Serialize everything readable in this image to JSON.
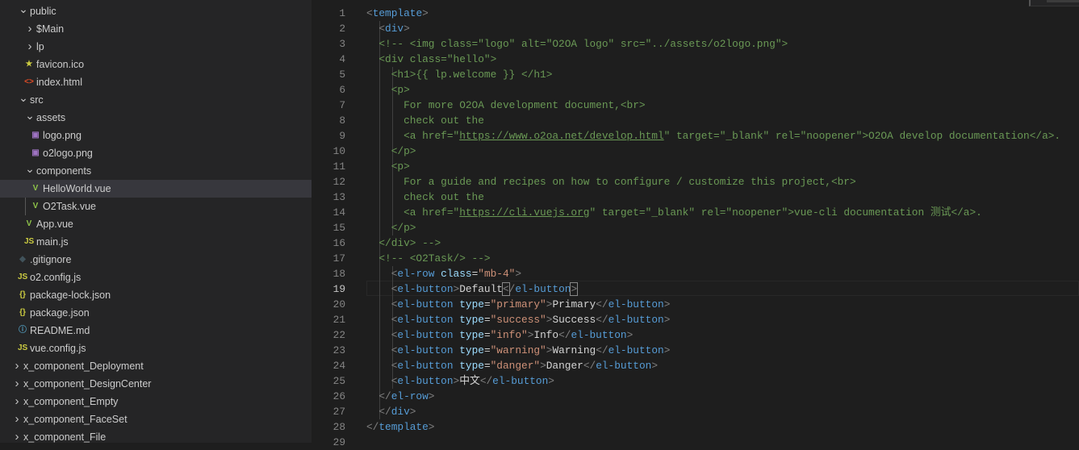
{
  "explorer": {
    "items": [
      {
        "label": "public",
        "kind": "folder-open",
        "level": 1
      },
      {
        "label": "$Main",
        "kind": "folder-closed",
        "level": 2
      },
      {
        "label": "lp",
        "kind": "folder-closed",
        "level": 2
      },
      {
        "label": "favicon.ico",
        "kind": "star",
        "level": 2
      },
      {
        "label": "index.html",
        "kind": "html",
        "level": 2
      },
      {
        "label": "src",
        "kind": "folder-open",
        "level": 1
      },
      {
        "label": "assets",
        "kind": "folder-open",
        "level": 2
      },
      {
        "label": "logo.png",
        "kind": "image",
        "level": 3
      },
      {
        "label": "o2logo.png",
        "kind": "image",
        "level": 3
      },
      {
        "label": "components",
        "kind": "folder-open",
        "level": 2
      },
      {
        "label": "HelloWorld.vue",
        "kind": "vue",
        "level": 3,
        "selected": true
      },
      {
        "label": "O2Task.vue",
        "kind": "vue",
        "level": 3
      },
      {
        "label": "App.vue",
        "kind": "vue",
        "level": 2
      },
      {
        "label": "main.js",
        "kind": "js",
        "level": 2
      },
      {
        "label": ".gitignore",
        "kind": "git",
        "level": 1
      },
      {
        "label": "o2.config.js",
        "kind": "js",
        "level": 1
      },
      {
        "label": "package-lock.json",
        "kind": "json",
        "level": 1
      },
      {
        "label": "package.json",
        "kind": "json",
        "level": 1
      },
      {
        "label": "README.md",
        "kind": "info",
        "level": 1
      },
      {
        "label": "vue.config.js",
        "kind": "js",
        "level": 1
      },
      {
        "label": "x_component_Deployment",
        "kind": "folder-closed",
        "level": 0
      },
      {
        "label": "x_component_DesignCenter",
        "kind": "folder-closed",
        "level": 0
      },
      {
        "label": "x_component_Empty",
        "kind": "folder-closed",
        "level": 0
      },
      {
        "label": "x_component_FaceSet",
        "kind": "folder-closed",
        "level": 0
      },
      {
        "label": "x_component_File",
        "kind": "folder-closed",
        "level": 0
      }
    ]
  },
  "icons": {
    "folder-open": "⌄",
    "folder-closed": "›",
    "star": "★",
    "html": "<>",
    "image": "▣",
    "vue": "V",
    "js": "JS",
    "git": "◆",
    "json": "{}",
    "info": "ⓘ"
  },
  "icon_colors": {
    "star": "#cbcb41",
    "html": "#e44d26",
    "image": "#a074c4",
    "vue": "#8dc149",
    "js": "#cbcb41",
    "git": "#41535b",
    "json": "#cbcb41",
    "info": "#519aba"
  },
  "editor": {
    "current_line": 19,
    "lines": [
      {
        "n": "1",
        "tokens": [
          [
            "p",
            "<"
          ],
          [
            "t",
            "template"
          ],
          [
            "p",
            ">"
          ]
        ]
      },
      {
        "n": "2",
        "tokens": [
          [
            "x",
            "  "
          ],
          [
            "p",
            "<"
          ],
          [
            "t",
            "div"
          ],
          [
            "p",
            ">"
          ]
        ]
      },
      {
        "n": "3",
        "tokens": [
          [
            "c",
            "  <!-- <img class=\"logo\" alt=\"O2OA logo\" src=\"../assets/o2logo.png\">"
          ]
        ]
      },
      {
        "n": "4",
        "tokens": [
          [
            "c",
            "  <div class=\"hello\">"
          ]
        ]
      },
      {
        "n": "5",
        "tokens": [
          [
            "c",
            "    <h1>{{ lp.welcome }} </h1>"
          ]
        ]
      },
      {
        "n": "6",
        "tokens": [
          [
            "c",
            "    <p>"
          ]
        ]
      },
      {
        "n": "7",
        "tokens": [
          [
            "c",
            "      For more O2OA development document,<br>"
          ]
        ]
      },
      {
        "n": "8",
        "tokens": [
          [
            "c",
            "      check out the"
          ]
        ]
      },
      {
        "n": "9",
        "tokens": [
          [
            "c",
            "      <a href=\""
          ],
          [
            "u",
            "https://www.o2oa.net/develop.html"
          ],
          [
            "c",
            "\" target=\"_blank\" rel=\"noopener\">O2OA develop documentation</a>."
          ]
        ]
      },
      {
        "n": "10",
        "tokens": [
          [
            "c",
            "    </p>"
          ]
        ]
      },
      {
        "n": "11",
        "tokens": [
          [
            "c",
            "    <p>"
          ]
        ]
      },
      {
        "n": "12",
        "tokens": [
          [
            "c",
            "      For a guide and recipes on how to configure / customize this project,<br>"
          ]
        ]
      },
      {
        "n": "13",
        "tokens": [
          [
            "c",
            "      check out the"
          ]
        ]
      },
      {
        "n": "14",
        "tokens": [
          [
            "c",
            "      <a href=\""
          ],
          [
            "u",
            "https://cli.vuejs.org"
          ],
          [
            "c",
            "\" target=\"_blank\" rel=\"noopener\">vue-cli documentation 测试</a>."
          ]
        ]
      },
      {
        "n": "15",
        "tokens": [
          [
            "c",
            "    </p>"
          ]
        ]
      },
      {
        "n": "16",
        "tokens": [
          [
            "c",
            "  </div> -->"
          ]
        ]
      },
      {
        "n": "17",
        "tokens": [
          [
            "c",
            "  <!-- <O2Task/> -->"
          ]
        ]
      },
      {
        "n": "18",
        "tokens": [
          [
            "x",
            "    "
          ],
          [
            "p",
            "<"
          ],
          [
            "t",
            "el-row"
          ],
          [
            "x",
            " "
          ],
          [
            "a",
            "class"
          ],
          [
            "x",
            "="
          ],
          [
            "s",
            "\"mb-4\""
          ],
          [
            "p",
            ">"
          ]
        ]
      },
      {
        "n": "19",
        "tokens": [
          [
            "x",
            "    "
          ],
          [
            "p",
            "<"
          ],
          [
            "t",
            "el-button"
          ],
          [
            "p",
            ">"
          ],
          [
            "x",
            "Default"
          ],
          [
            "b",
            "<"
          ],
          [
            "p",
            "/"
          ],
          [
            "t",
            "el-button"
          ],
          [
            "b",
            ">"
          ]
        ]
      },
      {
        "n": "20",
        "tokens": [
          [
            "x",
            "    "
          ],
          [
            "p",
            "<"
          ],
          [
            "t",
            "el-button"
          ],
          [
            "x",
            " "
          ],
          [
            "a",
            "type"
          ],
          [
            "x",
            "="
          ],
          [
            "s",
            "\"primary\""
          ],
          [
            "p",
            ">"
          ],
          [
            "x",
            "Primary"
          ],
          [
            "p",
            "</"
          ],
          [
            "t",
            "el-button"
          ],
          [
            "p",
            ">"
          ]
        ]
      },
      {
        "n": "21",
        "tokens": [
          [
            "x",
            "    "
          ],
          [
            "p",
            "<"
          ],
          [
            "t",
            "el-button"
          ],
          [
            "x",
            " "
          ],
          [
            "a",
            "type"
          ],
          [
            "x",
            "="
          ],
          [
            "s",
            "\"success\""
          ],
          [
            "p",
            ">"
          ],
          [
            "x",
            "Success"
          ],
          [
            "p",
            "</"
          ],
          [
            "t",
            "el-button"
          ],
          [
            "p",
            ">"
          ]
        ]
      },
      {
        "n": "22",
        "tokens": [
          [
            "x",
            "    "
          ],
          [
            "p",
            "<"
          ],
          [
            "t",
            "el-button"
          ],
          [
            "x",
            " "
          ],
          [
            "a",
            "type"
          ],
          [
            "x",
            "="
          ],
          [
            "s",
            "\"info\""
          ],
          [
            "p",
            ">"
          ],
          [
            "x",
            "Info"
          ],
          [
            "p",
            "</"
          ],
          [
            "t",
            "el-button"
          ],
          [
            "p",
            ">"
          ]
        ]
      },
      {
        "n": "23",
        "tokens": [
          [
            "x",
            "    "
          ],
          [
            "p",
            "<"
          ],
          [
            "t",
            "el-button"
          ],
          [
            "x",
            " "
          ],
          [
            "a",
            "type"
          ],
          [
            "x",
            "="
          ],
          [
            "s",
            "\"warning\""
          ],
          [
            "p",
            ">"
          ],
          [
            "x",
            "Warning"
          ],
          [
            "p",
            "</"
          ],
          [
            "t",
            "el-button"
          ],
          [
            "p",
            ">"
          ]
        ]
      },
      {
        "n": "24",
        "tokens": [
          [
            "x",
            "    "
          ],
          [
            "p",
            "<"
          ],
          [
            "t",
            "el-button"
          ],
          [
            "x",
            " "
          ],
          [
            "a",
            "type"
          ],
          [
            "x",
            "="
          ],
          [
            "s",
            "\"danger\""
          ],
          [
            "p",
            ">"
          ],
          [
            "x",
            "Danger"
          ],
          [
            "p",
            "</"
          ],
          [
            "t",
            "el-button"
          ],
          [
            "p",
            ">"
          ]
        ]
      },
      {
        "n": "25",
        "tokens": [
          [
            "x",
            "    "
          ],
          [
            "p",
            "<"
          ],
          [
            "t",
            "el-button"
          ],
          [
            "p",
            ">"
          ],
          [
            "x",
            "中文"
          ],
          [
            "p",
            "</"
          ],
          [
            "t",
            "el-button"
          ],
          [
            "p",
            ">"
          ]
        ]
      },
      {
        "n": "26",
        "tokens": [
          [
            "x",
            "  "
          ],
          [
            "p",
            "</"
          ],
          [
            "t",
            "el-row"
          ],
          [
            "p",
            ">"
          ]
        ]
      },
      {
        "n": "27",
        "tokens": [
          [
            "x",
            "  "
          ],
          [
            "p",
            "</"
          ],
          [
            "t",
            "div"
          ],
          [
            "p",
            ">"
          ]
        ]
      },
      {
        "n": "28",
        "tokens": [
          [
            "p",
            "</"
          ],
          [
            "t",
            "template"
          ],
          [
            "p",
            ">"
          ]
        ]
      },
      {
        "n": "29",
        "tokens": []
      }
    ]
  }
}
